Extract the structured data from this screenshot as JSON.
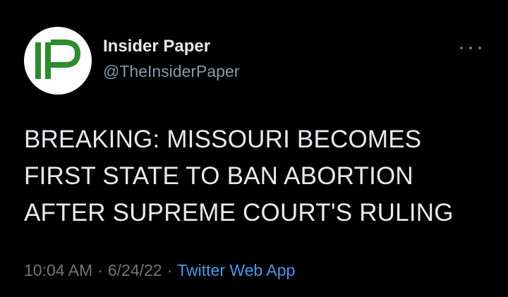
{
  "tweet": {
    "author": {
      "avatar_letters": "IP",
      "avatar_colors": {
        "ring": "#2e8b2f",
        "text": "#2e8b2f",
        "background": "#ffffff"
      },
      "display_name": "Insider Paper",
      "handle": "@TheInsiderPaper"
    },
    "more_icon": "more-horizontal-icon",
    "text": "BREAKING: MISSOURI BECOMES\nFIRST STATE TO BAN ABORTION\nAFTER SUPREME COURT'S RULING",
    "time": "10:04 AM",
    "separator": "·",
    "date": "6/24/22",
    "source": "Twitter Web App"
  },
  "colors": {
    "background": "#000000",
    "primary_text": "#e7e9ea",
    "secondary_text": "#6e767d",
    "link": "#4a99e9"
  }
}
